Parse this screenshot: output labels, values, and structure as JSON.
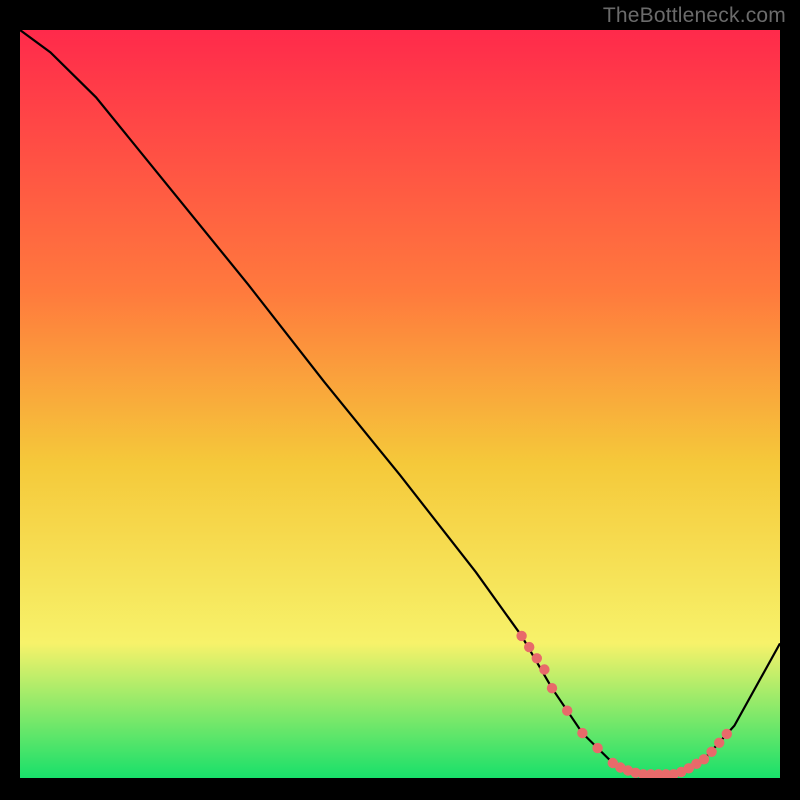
{
  "watermark": "TheBottleneck.com",
  "colors": {
    "bg": "#000000",
    "grad_top": "#ff2a4b",
    "grad_mid1": "#ff7a3d",
    "grad_mid2": "#f5c93a",
    "grad_mid3": "#f7f26a",
    "grad_bottom": "#18e06a",
    "curve": "#000000",
    "marker": "#e86a6a"
  },
  "chart_data": {
    "type": "line",
    "title": "",
    "xlabel": "",
    "ylabel": "",
    "xlim": [
      0,
      100
    ],
    "ylim": [
      0,
      100
    ],
    "series": [
      {
        "name": "bottleneck-curve",
        "x": [
          0,
          4,
          10,
          20,
          30,
          40,
          50,
          60,
          66,
          70,
          74,
          78,
          82,
          86,
          90,
          94,
          100
        ],
        "y": [
          100,
          97,
          91,
          78.5,
          66,
          53,
          40.5,
          27.5,
          19,
          12,
          6,
          2,
          0.5,
          0.5,
          2.5,
          7,
          18
        ]
      }
    ],
    "markers": {
      "name": "highlight-band",
      "x": [
        66,
        67,
        68,
        69,
        70,
        72,
        74,
        76,
        78,
        79,
        80,
        81,
        82,
        83,
        84,
        85,
        86,
        87,
        88,
        89,
        90,
        91,
        92,
        93
      ],
      "y": [
        19,
        17.5,
        16,
        14.5,
        12,
        9,
        6,
        4,
        2,
        1.4,
        1,
        0.7,
        0.5,
        0.5,
        0.5,
        0.5,
        0.5,
        0.8,
        1.3,
        1.9,
        2.5,
        3.5,
        4.7,
        5.9
      ]
    }
  }
}
